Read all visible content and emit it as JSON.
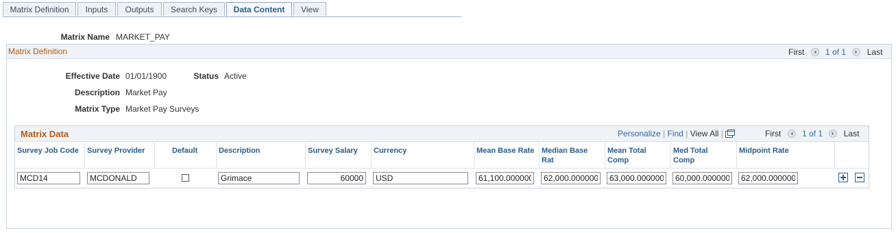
{
  "tabs": [
    {
      "label": "Matrix Definition"
    },
    {
      "label": "Inputs"
    },
    {
      "label": "Outputs"
    },
    {
      "label": "Search Keys"
    },
    {
      "label": "Data Content",
      "active": true
    },
    {
      "label": "View"
    }
  ],
  "header": {
    "matrix_name_label": "Matrix Name",
    "matrix_name_value": "MARKET_PAY"
  },
  "matrix_definition": {
    "title": "Matrix Definition",
    "nav": {
      "first": "First",
      "range": "1 of 1",
      "last": "Last"
    },
    "effective_date_label": "Effective Date",
    "effective_date_value": "01/01/1900",
    "status_label": "Status",
    "status_value": "Active",
    "description_label": "Description",
    "description_value": "Market Pay",
    "matrix_type_label": "Matrix Type",
    "matrix_type_value": "Market Pay Surveys"
  },
  "matrix_data": {
    "title": "Matrix Data",
    "personalize": "Personalize",
    "find": "Find",
    "view_all": "View All",
    "nav": {
      "first": "First",
      "range": "1 of 1",
      "last": "Last"
    },
    "columns": [
      "Survey Job Code",
      "Survey Provider",
      "Default",
      "Description",
      "Survey Salary",
      "Currency",
      "Mean Base Rate",
      "Median Base Rat",
      "Mean Total Comp",
      "Med Total Comp",
      "Midpoint Rate"
    ],
    "row": {
      "survey_job_code": "MCD14",
      "survey_provider": "MCDONALD",
      "default_checked": false,
      "description": "Grimace",
      "survey_salary": "60000",
      "currency": "USD",
      "mean_base_rate": "61,100.000000",
      "median_base_rate": "62,000.000000",
      "mean_total_comp": "63,000.000000",
      "med_total_comp": "60,000.000000",
      "midpoint_rate": "62,000.000000"
    }
  },
  "colors": {
    "accent": "#2b5d8a",
    "section_title": "#b35a14",
    "link": "#3366a8"
  },
  "icons": [
    "first-arrow-icon",
    "last-arrow-icon",
    "popout-grid-icon",
    "add-row-icon",
    "delete-row-icon"
  ]
}
